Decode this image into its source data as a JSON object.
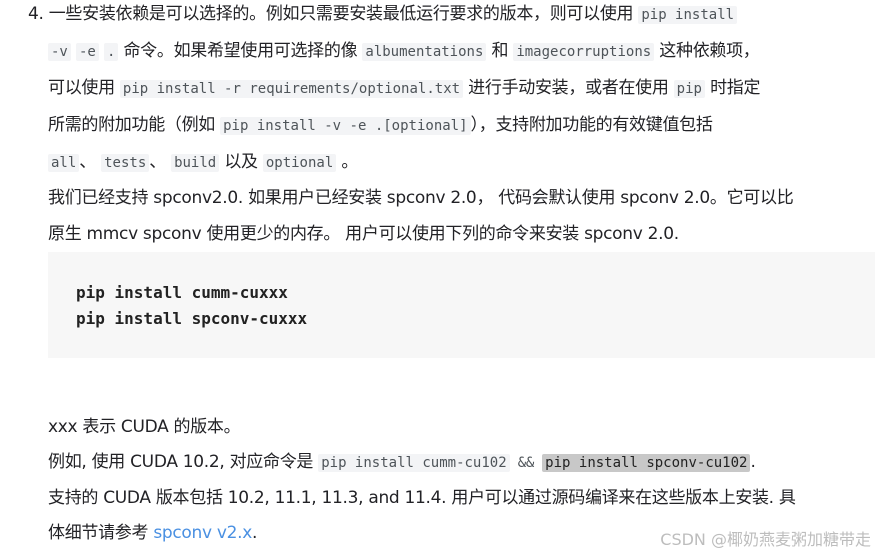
{
  "item4": {
    "number": "4.",
    "l1_text": "一些安装依赖是可以选择的。例如只需要安装最低运行要求的版本，则可以使用 ",
    "l1_code": "pip install",
    "l2_code1": "-v",
    "l2_code2": "-e",
    "l2_code3": ".",
    "l2_text1": " 命令。如果希望使用可选择的像 ",
    "l2_code4": "albumentations",
    "l2_text2": " 和 ",
    "l2_code5": "imagecorruptions",
    "l2_text3": " 这种依赖项，",
    "l3_text1": "可以使用 ",
    "l3_code1": "pip install -r requirements/optional.txt",
    "l3_text2": "  进行手动安装，或者在使用 ",
    "l3_code2": "pip",
    "l3_text3": " 时指定",
    "l4_text1": "所需的附加功能（例如 ",
    "l4_code1": "pip install -v -e .[optional]",
    "l4_text2": "），支持附加功能的有效键值包括",
    "l5_code1": "all",
    "l5_sep1": "、 ",
    "l5_code2": "tests",
    "l5_sep2": "、 ",
    "l5_code3": "build",
    "l5_text1": " 以及 ",
    "l5_code4": "optional",
    "l5_text2": " 。"
  },
  "spconv": {
    "l1": "我们已经支持 spconv2.0. 如果用户已经安装 spconv 2.0， 代码会默认使用 spconv 2.0。它可以比",
    "l2": "原生 mmcv spconv 使用更少的内存。 用户可以使用下列的命令来安装 spconv 2.0.",
    "code_lines": "pip install cumm-cuxxx\npip install spconv-cuxxx"
  },
  "cuda": {
    "l1": "xxx 表示 CUDA 的版本。",
    "l2_text": "例如, 使用 CUDA 10.2, 对应命令是 ",
    "l2_code1": "pip install cumm-cu102",
    "l2_amp": " && ",
    "l2_code2": "pip install spconv-cu102",
    "l2_end": ".",
    "l3": "支持的 CUDA 版本包括 10.2, 11.1, 11.3, and 11.4. 用户可以通过源码编译来在这些版本上安装. 具",
    "l4_text": "体细节请参考 ",
    "l4_link": "spconv v2.x",
    "l4_end": "."
  },
  "watermark": "CSDN @椰奶燕麦粥加糖带走"
}
